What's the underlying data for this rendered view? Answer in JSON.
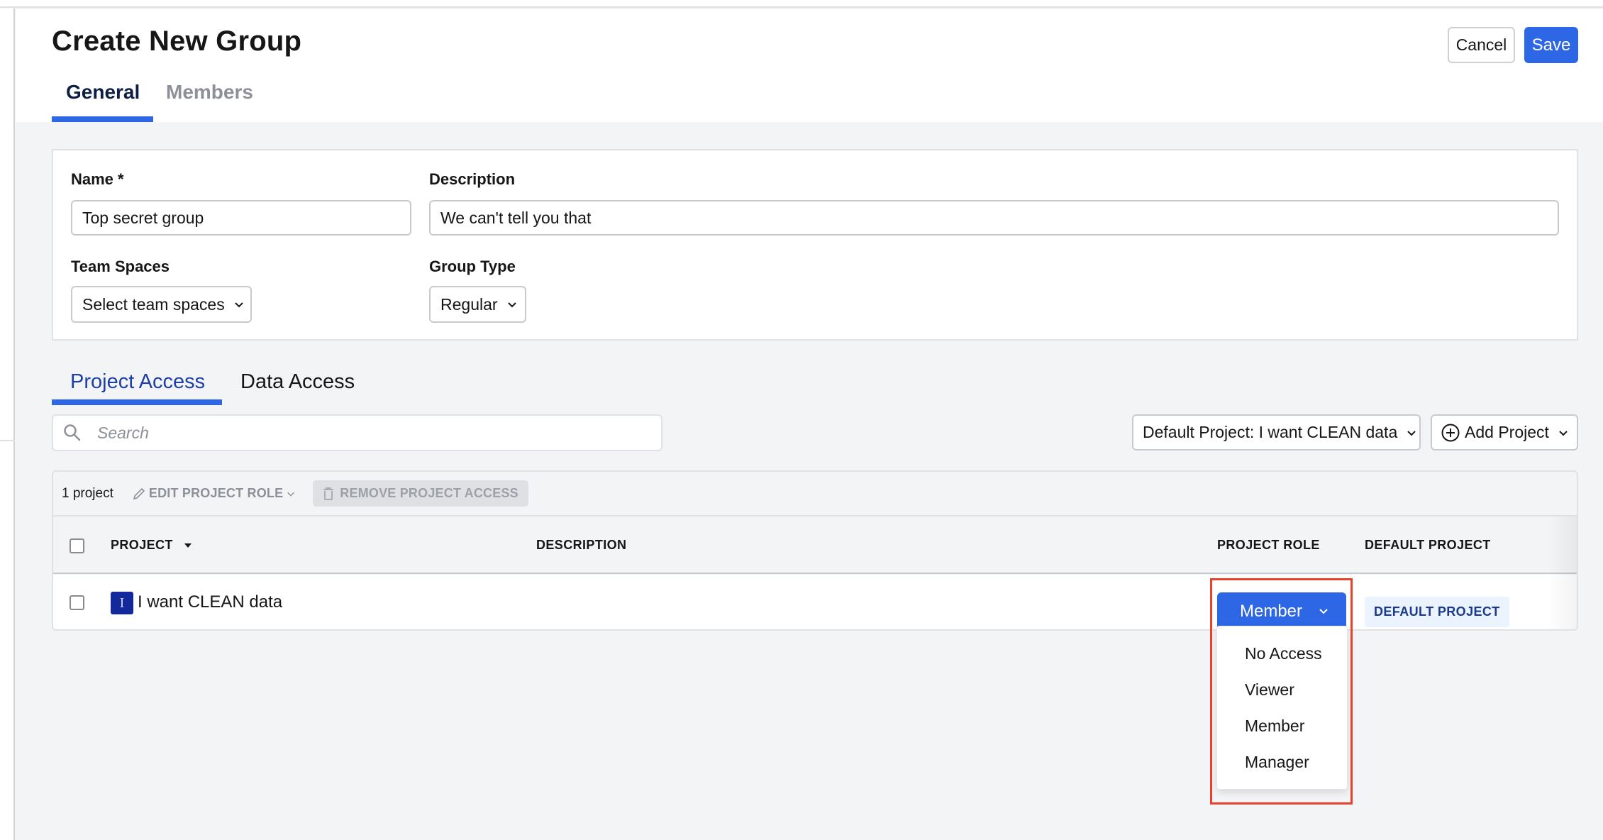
{
  "page": {
    "title": "Create New Group",
    "actions": {
      "cancel_label": "Cancel",
      "save_label": "Save"
    },
    "tabs": [
      {
        "label": "General",
        "active": true
      },
      {
        "label": "Members",
        "active": false
      }
    ]
  },
  "form": {
    "name": {
      "label": "Name *",
      "value": "Top secret group"
    },
    "description": {
      "label": "Description",
      "value": "We can't tell you that"
    },
    "team_spaces": {
      "label": "Team Spaces",
      "value": "Select team spaces"
    },
    "group_type": {
      "label": "Group Type",
      "value": "Regular"
    }
  },
  "access": {
    "tabs": [
      {
        "label": "Project Access",
        "active": true
      },
      {
        "label": "Data Access",
        "active": false
      }
    ],
    "search": {
      "placeholder": "Search",
      "value": ""
    },
    "default_project_dropdown": "Default Project: I want CLEAN data",
    "add_project_label": "Add Project"
  },
  "table": {
    "toolbar": {
      "count": "1 project",
      "edit_role_label": "EDIT PROJECT ROLE",
      "remove_access_label": "REMOVE PROJECT ACCESS"
    },
    "columns": [
      "PROJECT",
      "DESCRIPTION",
      "PROJECT ROLE",
      "DEFAULT PROJECT"
    ],
    "rows": [
      {
        "icon_letter": "I",
        "project": "I want CLEAN data",
        "description": "",
        "role": "Member",
        "default_badge": "DEFAULT PROJECT"
      }
    ]
  },
  "role_menu": {
    "options": [
      "No Access",
      "Viewer",
      "Member",
      "Manager"
    ]
  },
  "colors": {
    "accent": "#2d67e6",
    "highlight": "#e8412c",
    "project_icon": "#13299b",
    "badge_bg": "#ebf3ff"
  }
}
